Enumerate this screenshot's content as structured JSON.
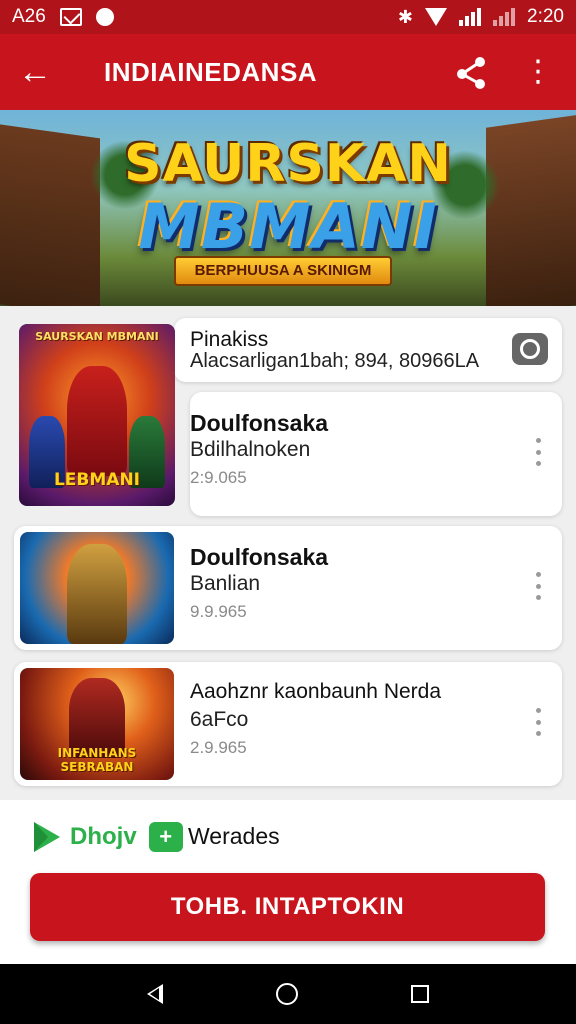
{
  "status_bar": {
    "left_text": "A26",
    "time": "2:20"
  },
  "app_bar": {
    "back_icon": "arrow-back-icon",
    "title": "INDIAINEDANSA",
    "share_icon": "share-icon",
    "more_icon": "more-vert-icon"
  },
  "banner": {
    "line1": "SAURSKAN",
    "line2": "MBMANI",
    "subtitle": "BERPHUUSA A SKINIGM"
  },
  "items": [
    {
      "title": "Pinakiss",
      "subtitle": "Alacsarligan1bah; 894, 80966LA",
      "thumb_caption": "LEBMANI",
      "thumb_top_text": "SAURSKAN MBMANI"
    },
    {
      "title": "Doulfonsaka",
      "subtitle": "Bdilhalnoken",
      "meta": "2:9.065"
    },
    {
      "title": "Doulfonsaka",
      "subtitle": "Banlian",
      "meta": "9.9.965"
    },
    {
      "title": "Aaohznr kaonbaunh Nerda",
      "subtitle": "6aFco",
      "meta": "2.9.965",
      "thumb_caption": "INFANHANS SEBRABAN"
    }
  ],
  "footer": {
    "brand_word": "Dhojv",
    "brand_badge": "+",
    "label": "Werades",
    "cta_label": "TOHB. INTAPTOKIN"
  },
  "colors": {
    "primary": "#c8141c",
    "status": "#b0141a",
    "brand_green": "#2bb04a"
  }
}
